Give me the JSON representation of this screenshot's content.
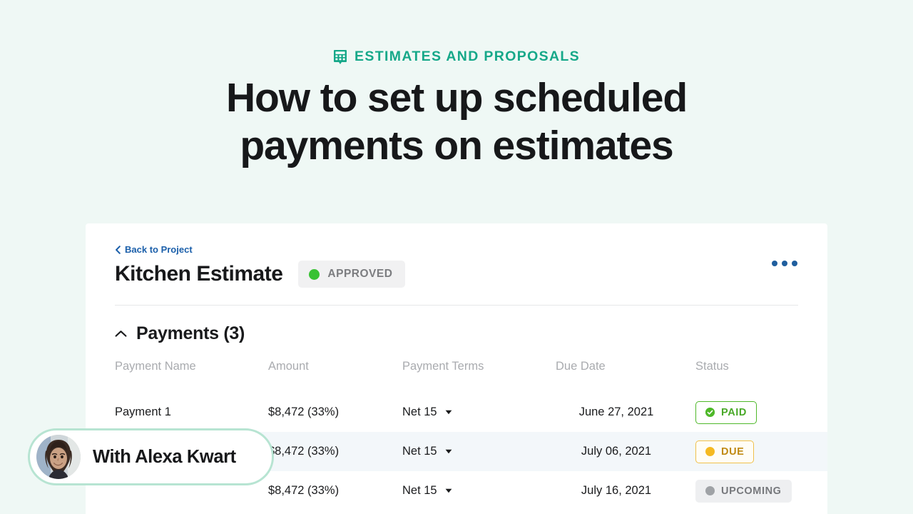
{
  "hero": {
    "eyebrow_icon": "calculator-icon",
    "eyebrow": "ESTIMATES AND PROPOSALS",
    "title_line1": "How to set up scheduled",
    "title_line2": "payments on estimates",
    "accent_color": "#16a889",
    "background_color": "#eff8f5"
  },
  "card": {
    "back_link": "Back to Project",
    "back_link_icon": "chevron-left-icon",
    "back_link_color": "#1b5faa",
    "estimate_title": "Kitchen Estimate",
    "status_badge": {
      "label": "APPROVED",
      "dot_color": "#38c233",
      "background": "#f1f1f2"
    },
    "overflow_menu_icon": "kebab-menu-icon",
    "overflow_menu_color": "#1f5e9e"
  },
  "payments_section": {
    "collapse_icon": "chevron-up-icon",
    "heading": "Payments (3)",
    "columns": [
      "Payment Name",
      "Amount",
      "Payment Terms",
      "Due Date",
      "Status"
    ],
    "rows": [
      {
        "name": "Payment 1",
        "amount": "$8,472 (33%)",
        "terms": "Net 15",
        "terms_icon": "chevron-down-icon",
        "due_date": "June 27, 2021",
        "status": "PAID",
        "status_kind": "paid",
        "status_icon": "check-circle-icon",
        "status_color": "#49a928",
        "highlighted": false
      },
      {
        "name": "",
        "amount": "$8,472 (33%)",
        "terms": "Net 15",
        "terms_icon": "chevron-down-icon",
        "due_date": "July 06, 2021",
        "status": "DUE",
        "status_kind": "due",
        "status_icon": "dot-icon",
        "status_color": "#c08a12",
        "highlighted": true
      },
      {
        "name": "",
        "amount": "$8,472 (33%)",
        "terms": "Net 15",
        "terms_icon": "chevron-down-icon",
        "due_date": "July 16, 2021",
        "status": "UPCOMING",
        "status_kind": "upcoming",
        "status_icon": "dot-icon",
        "status_color": "#76787c",
        "highlighted": false
      }
    ]
  },
  "presenter": {
    "avatar_icon": "presenter-avatar",
    "name": "With Alexa Kwart",
    "border_color": "#b7e4d2"
  }
}
